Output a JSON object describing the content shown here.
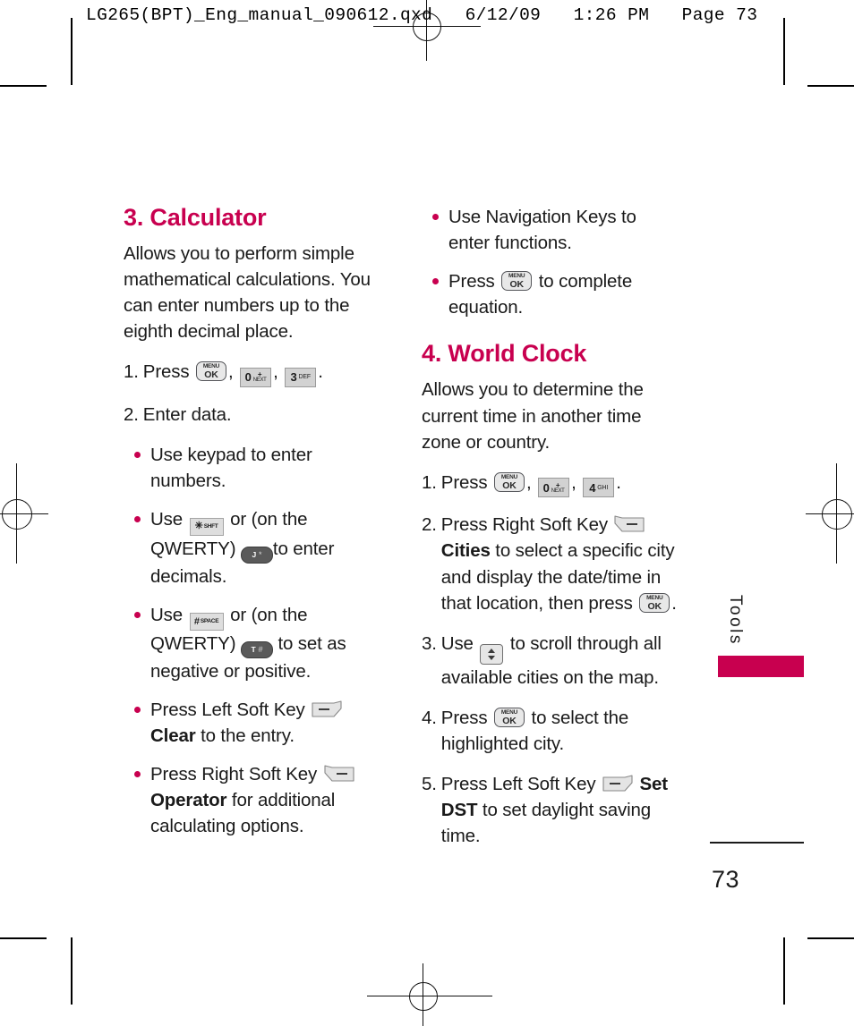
{
  "prepress": {
    "header_text": "LG265(BPT)_Eng_manual_090612.qxd   6/12/09   1:26 PM   Page 73"
  },
  "colors": {
    "accent": "#C8004F",
    "text": "#1A1A1A",
    "key_light": "#E8E8E8",
    "key_num": "#D2D2D2",
    "key_sym": "#DEDEDE",
    "key_qwerty_dark": "#5A5A5A"
  },
  "keys": {
    "menu_ok": {
      "line1": "MENU",
      "line2": "OK",
      "name": "menu-ok-key"
    },
    "zero_next": {
      "digit": "0",
      "plus": "+",
      "sub": "NEXT",
      "name": "zero-next-key"
    },
    "three_def": {
      "digit": "3",
      "sub": "DEF",
      "name": "three-def-key"
    },
    "four_ghi": {
      "digit": "4",
      "sub": "GHI",
      "name": "four-ghi-key"
    },
    "star_shift": {
      "symbol": "✳",
      "sub": "SHFT",
      "name": "star-shift-key"
    },
    "hash_space": {
      "symbol": "#",
      "sub": "SPACE",
      "name": "hash-space-key"
    },
    "qwerty_j": {
      "label": "J",
      "symbol": "*",
      "name": "qwerty-j-key"
    },
    "qwerty_t": {
      "label": "T",
      "symbol": "#",
      "name": "qwerty-t-key"
    },
    "left_soft": {
      "name": "left-soft-key"
    },
    "right_soft": {
      "name": "right-soft-key"
    },
    "up_down": {
      "name": "up-down-nav-key"
    }
  },
  "left_column": {
    "heading": "3. Calculator",
    "intro": "Allows you to perform simple mathematical calculations. You can enter numbers up to the eighth decimal place.",
    "step1": {
      "number": "1.",
      "text_before": "Press",
      "comma1": ",",
      "comma2": ",",
      "period": "."
    },
    "step2": {
      "number": "2.",
      "text": "Enter data."
    },
    "bullets": [
      {
        "text": "Use keypad to enter numbers."
      },
      {
        "pre": "Use",
        "mid": "or (on the QWERTY)",
        "post": "to enter decimals."
      },
      {
        "pre": "Use",
        "mid": "or (on the QWERTY)",
        "post": "to set as negative or positive."
      },
      {
        "pre": "Press Left Soft Key",
        "bold": "Clear",
        "post": "to the entry."
      },
      {
        "pre": "Press Right Soft Key",
        "bold": "Operator",
        "post": "for additional calculating options."
      }
    ]
  },
  "right_column": {
    "top_bullets": [
      {
        "text": "Use Navigation Keys to enter functions."
      },
      {
        "pre": "Press",
        "post": "to complete equation."
      }
    ],
    "heading": "4. World Clock",
    "intro": "Allows you to determine the current time in another time zone or country.",
    "steps": [
      {
        "number": "1.",
        "text_before": "Press",
        "comma1": ",",
        "comma2": ",",
        "period": "."
      },
      {
        "number": "2.",
        "pre": "Press Right Soft Key",
        "bold": "Cities",
        "mid": "to select a specific city and display the date/time in that location, then press",
        "post": "."
      },
      {
        "number": "3.",
        "pre": "Use",
        "post": "to scroll through all available cities on the map."
      },
      {
        "number": "4.",
        "pre": "Press",
        "post": "to select the highlighted city."
      },
      {
        "number": "5.",
        "pre": "Press Left Soft Key",
        "bold": "Set DST",
        "post": "to set daylight saving time."
      }
    ]
  },
  "side_tab": {
    "label": "Tools"
  },
  "footer": {
    "page_number": "73"
  }
}
